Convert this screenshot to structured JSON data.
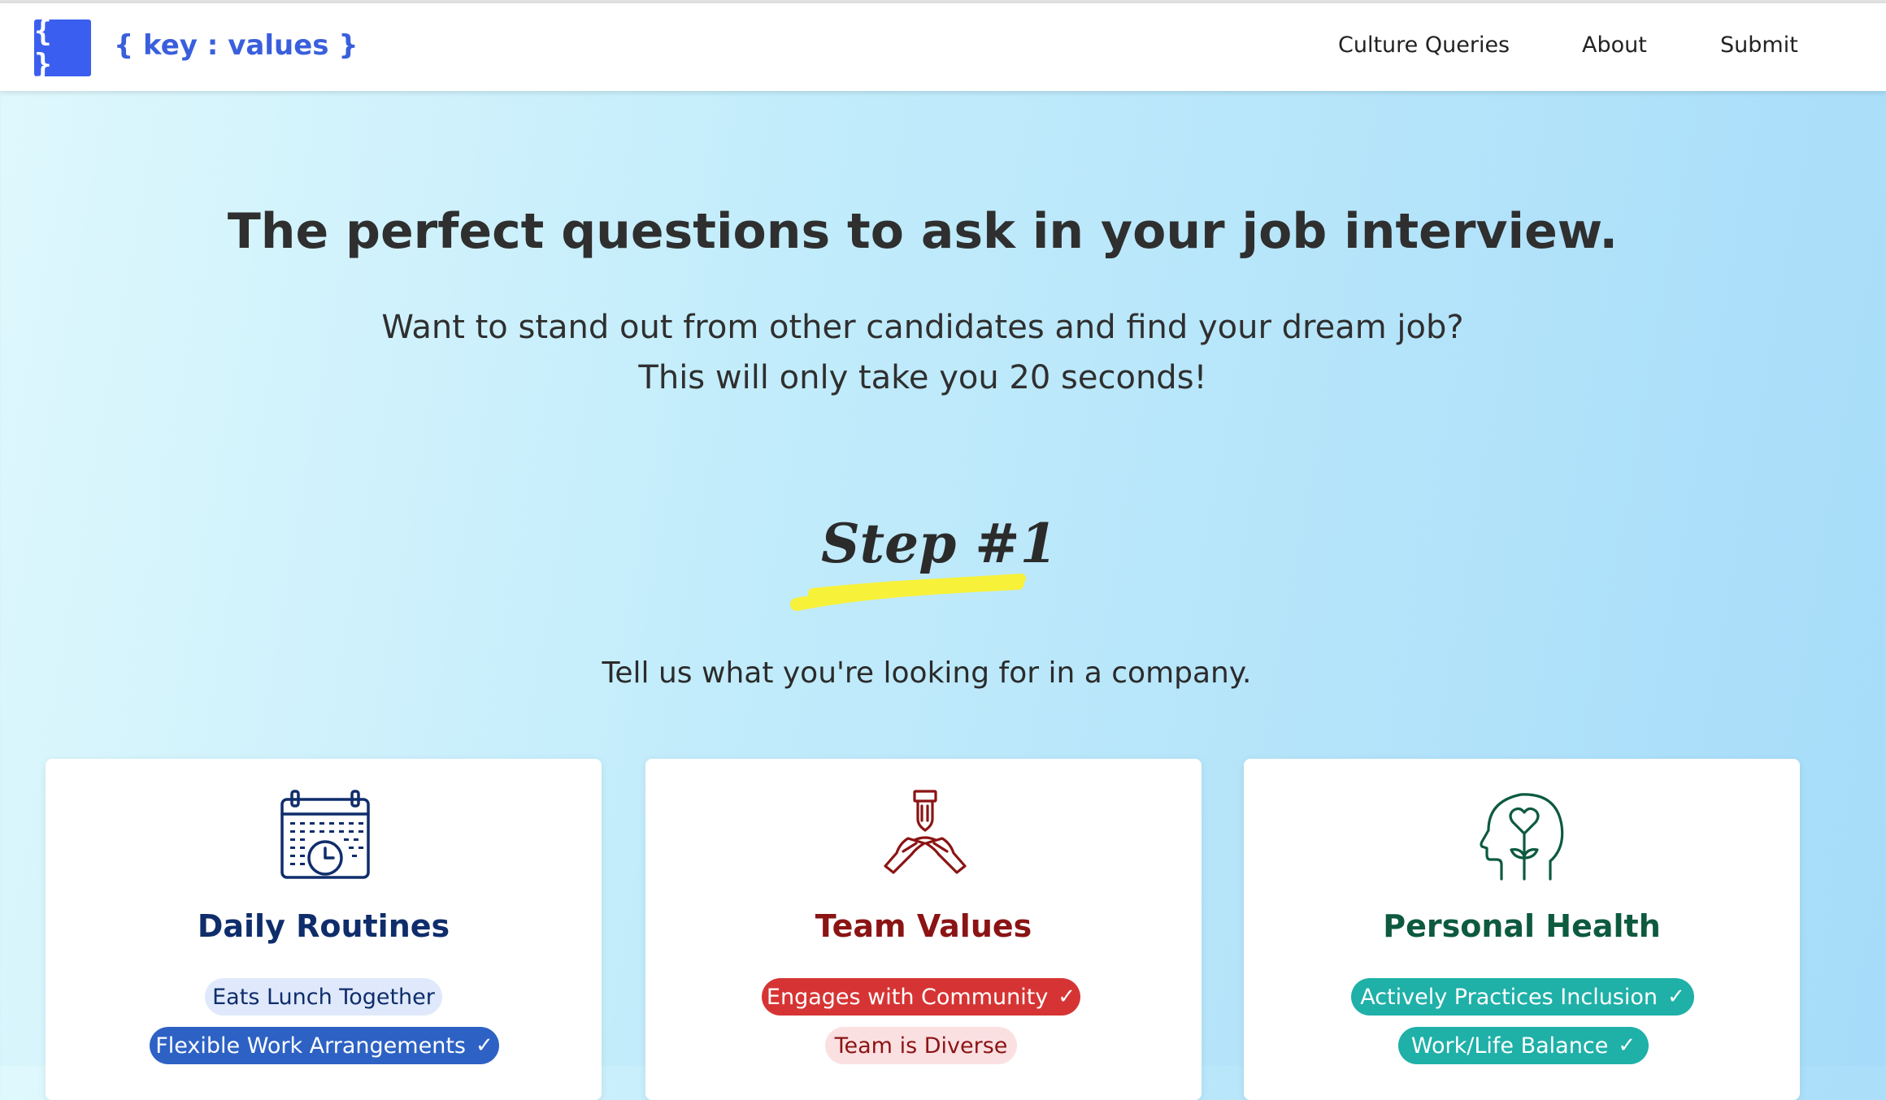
{
  "nav": {
    "logo_glyph": "{ }",
    "brand": "{ key : values }",
    "links": [
      "Culture Queries",
      "About",
      "Submit"
    ]
  },
  "hero": {
    "headline": "The perfect questions to ask in your job interview.",
    "sub_line_1": "Want to stand out from other candidates and find your dream job?",
    "sub_line_2": "This will only take you 20 seconds!"
  },
  "step": {
    "label": "Step #1",
    "highlight_color": "#f7f13a",
    "prompt": "Tell us what you're looking for in a company."
  },
  "cards": [
    {
      "title": "Daily Routines",
      "icon": "calendar-clock-icon",
      "color": "#0f2d6b",
      "chips": [
        {
          "label": "Eats Lunch Together",
          "selected": false
        },
        {
          "label": "Flexible Work Arrangements",
          "selected": true
        }
      ]
    },
    {
      "title": "Team Values",
      "icon": "team-hands-icon",
      "color": "#8b1414",
      "chips": [
        {
          "label": "Engages with Community",
          "selected": true
        },
        {
          "label": "Team is Diverse",
          "selected": false
        }
      ]
    },
    {
      "title": "Personal Health",
      "icon": "mind-heart-icon",
      "color": "#0d5a3f",
      "chips": [
        {
          "label": "Actively Practices Inclusion",
          "selected": true
        },
        {
          "label": "Work/Life Balance",
          "selected": true
        }
      ]
    }
  ],
  "check_glyph": "✓"
}
